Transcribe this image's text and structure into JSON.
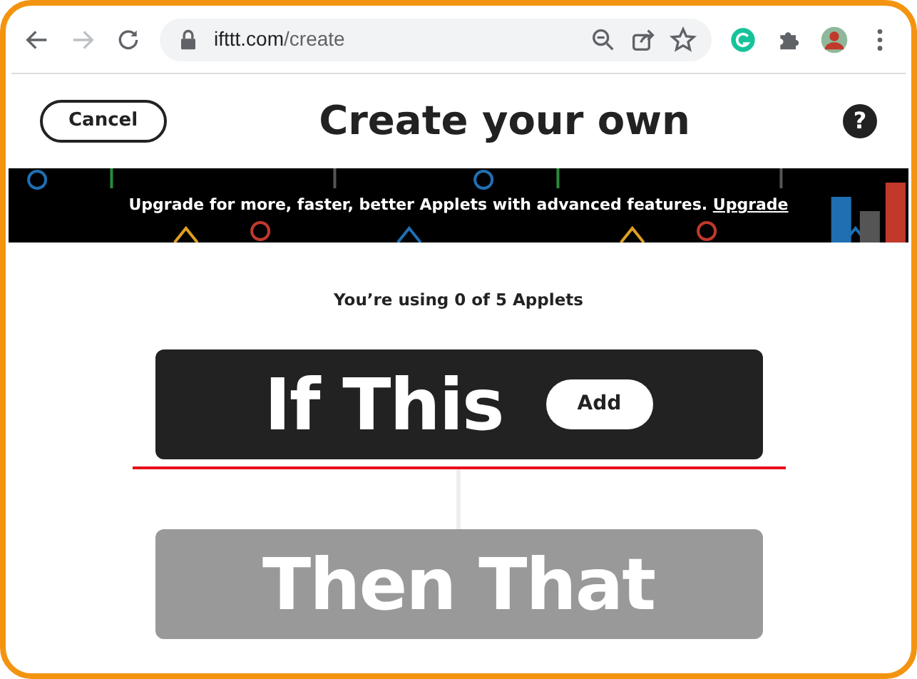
{
  "browser": {
    "url_host": "ifttt.com",
    "url_path": "/create",
    "forward_disabled": true
  },
  "header": {
    "cancel": "Cancel",
    "title": "Create your own",
    "help": "?"
  },
  "banner": {
    "text": "Upgrade for more, faster, better Applets with advanced features.",
    "link": "Upgrade"
  },
  "usage": "You’re using 0 of 5 Applets",
  "steps": [
    {
      "label": "If This",
      "button": "Add",
      "disabled": false
    },
    {
      "label": "Then That",
      "disabled": true
    }
  ]
}
